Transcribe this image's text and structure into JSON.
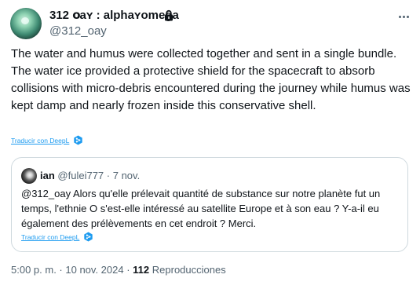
{
  "author": {
    "display_name": "312  օаʏ : alphаʏomega",
    "handle": "@312_oay",
    "protected": true
  },
  "more_icon": "more-horizontal-icon",
  "tweet": {
    "text": "The water and humus were collected together and sent in a single bundle. The water ice provided a protective shield for the spacecraft to absorb collisions with micro-debris encountered during the journey while humus was kept damp and nearly frozen inside this conservative shell.",
    "translate_label": "Traducir con DeepL"
  },
  "quote": {
    "name": "ian",
    "handle": "@fulei777",
    "separator": " · ",
    "date": "7 nov.",
    "text": "@312_oay Alors qu'elle prélevait quantité de substance sur notre planète fut un temps, l'ethnie O s'est-elle intéressé au satellite Europe et à son eau ? Y-a-il eu également des prélèvements en cet endroit ? Merci.",
    "translate_label": "Traducir con DeepL"
  },
  "meta": {
    "time": "5:00 p. m.",
    "separator": " · ",
    "date": "10 nov. 2024",
    "views_count": "112",
    "views_label": "Reproducciones"
  },
  "colors": {
    "link": "#1d9bf0",
    "secondary_text": "#536471",
    "border": "#cfd9de"
  }
}
